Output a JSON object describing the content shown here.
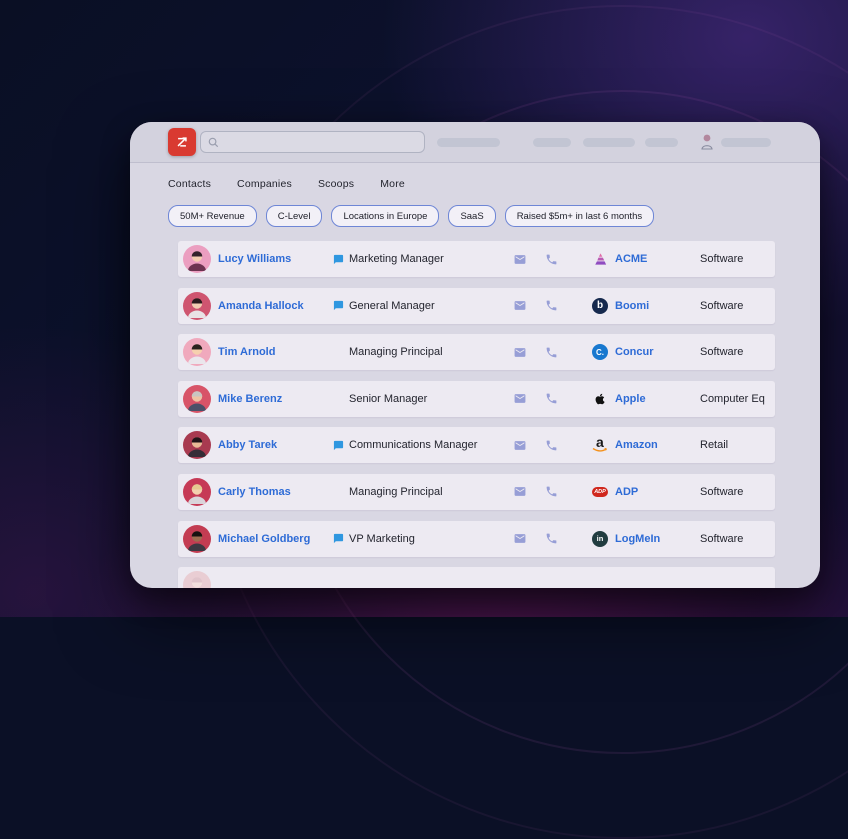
{
  "app": {
    "name": "ZoomInfo",
    "icons": {
      "logo": "zoominfo-z-arrow-icon",
      "search": "magnifier-icon",
      "user": "person-icon",
      "scoop": "speech-bubble-icon",
      "email": "envelope-icon",
      "phone": "handset-icon"
    },
    "colors": {
      "logo_red": "#d93a31",
      "accent_blue": "#2e6bd6",
      "scoop_blue": "#2f97e0",
      "icon_periwinkle": "#979ed6",
      "chip_border": "#6e86d6",
      "card_bg": "#d9d7e3",
      "row_bg": "#edeaf2"
    }
  },
  "header": {
    "search": {
      "value": "",
      "placeholder": ""
    }
  },
  "tabs": [
    {
      "label": "Contacts"
    },
    {
      "label": "Companies"
    },
    {
      "label": "Scoops"
    },
    {
      "label": "More"
    }
  ],
  "filters": [
    {
      "label": "50M+ Revenue"
    },
    {
      "label": "C-Level"
    },
    {
      "label": "Locations in Europe"
    },
    {
      "label": "SaaS"
    },
    {
      "label": "Raised $5m+ in last 6 months"
    }
  ],
  "table": {
    "rows": [
      {
        "name": "Lucy Williams",
        "title": "Marketing Manager",
        "has_scoop": true,
        "company": "ACME",
        "industry": "Software",
        "logo": {
          "type": "acme"
        },
        "avatar": {
          "bg": "#eb9ec0",
          "skin": "#f3cdb0",
          "hair": "#33222b",
          "shirt": "#6c3350"
        }
      },
      {
        "name": "Amanda Hallock",
        "title": "General Manager",
        "has_scoop": true,
        "company": "Boomi",
        "industry": "Software",
        "logo": {
          "type": "boomi",
          "monogram": "b"
        },
        "avatar": {
          "bg": "#cf5570",
          "skin": "#f3cdb2",
          "hair": "#2c1b1e",
          "shirt": "#e9e3e6"
        }
      },
      {
        "name": "Tim Arnold",
        "title": "Managing Principal",
        "has_scoop": false,
        "company": "Concur",
        "industry": "Software",
        "logo": {
          "type": "concur",
          "monogram": "C."
        },
        "avatar": {
          "bg": "#f0a9bd",
          "skin": "#f6d0ae",
          "hair": "#2a211d",
          "shirt": "#eae6ec"
        }
      },
      {
        "name": "Mike Berenz",
        "title": "Senior Manager",
        "has_scoop": false,
        "company": "Apple",
        "industry": "Computer Eq",
        "logo": {
          "type": "apple"
        },
        "avatar": {
          "bg": "#d85468",
          "skin": "#efc3a3",
          "hair": "#c9c5c1",
          "shirt": "#4b5068"
        }
      },
      {
        "name": "Abby Tarek",
        "title": "Communications Manager",
        "has_scoop": true,
        "company": "Amazon",
        "industry": "Retail",
        "logo": {
          "type": "amazon",
          "monogram": "a"
        },
        "avatar": {
          "bg": "#a83a50",
          "skin": "#e9ba96",
          "hair": "#201418",
          "shirt": "#342c36"
        }
      },
      {
        "name": "Carly Thomas",
        "title": "Managing Principal",
        "has_scoop": false,
        "company": "ADP",
        "industry": "Software",
        "logo": {
          "type": "adp",
          "monogram": "ADP"
        },
        "avatar": {
          "bg": "#c63a56",
          "skin": "#f4d0af",
          "hair": "#e5cb90",
          "shirt": "#dad4da"
        }
      },
      {
        "name": "Michael Goldberg",
        "title": "VP Marketing",
        "has_scoop": true,
        "company": "LogMeIn",
        "industry": "Software",
        "logo": {
          "type": "logmein",
          "monogram": "in"
        },
        "avatar": {
          "bg": "#c33c52",
          "skin": "#9e6c50",
          "hair": "#171210",
          "shirt": "#3e3842"
        }
      },
      {
        "name": "",
        "title": "",
        "has_scoop": false,
        "company": "",
        "industry": "",
        "logo": {
          "type": "none"
        },
        "avatar": {
          "bg": "#e9cdd3",
          "skin": "#f2dfdd",
          "hair": "#e0c4cb",
          "shirt": "#eadfe3"
        }
      }
    ]
  }
}
